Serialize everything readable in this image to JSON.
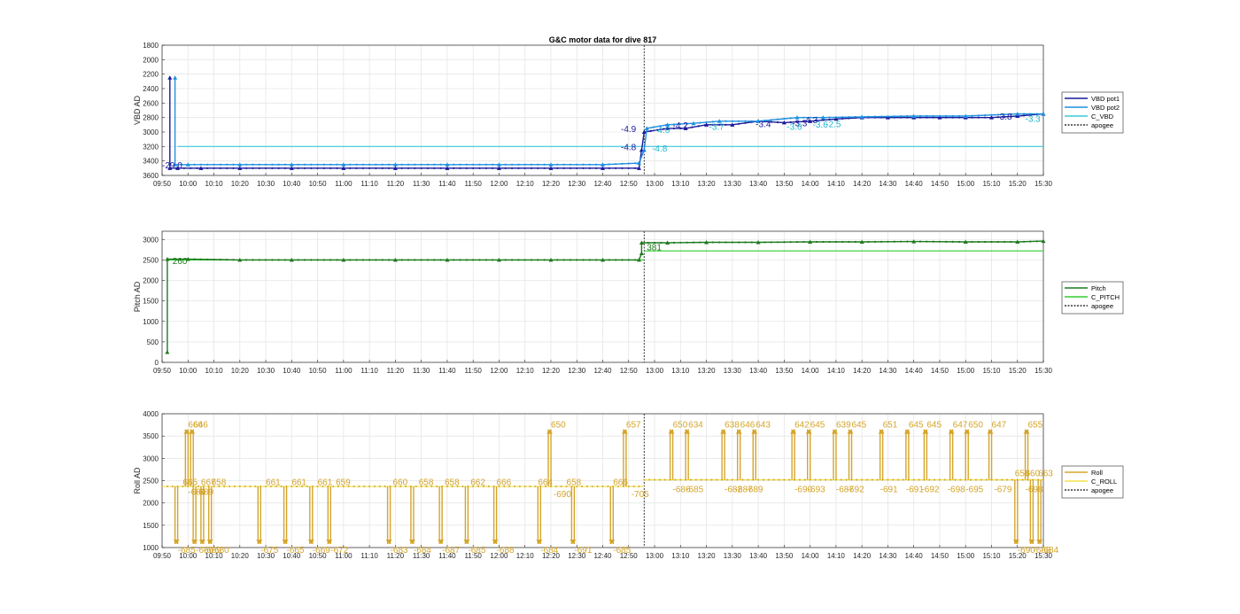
{
  "chart_data": [
    {
      "type": "line",
      "title": "G&C motor data for dive 817",
      "ylabel": "VBD AD",
      "ylim": [
        1800,
        3600
      ],
      "y_reversed": true,
      "yticks": [
        1800,
        2000,
        2200,
        2400,
        2600,
        2800,
        3000,
        3200,
        3400,
        3600
      ],
      "xlim": [
        "09:50",
        "15:30"
      ],
      "xticks": [
        "09:50",
        "10:00",
        "10:10",
        "10:20",
        "10:30",
        "10:40",
        "10:50",
        "11:00",
        "11:10",
        "11:20",
        "11:30",
        "11:40",
        "11:50",
        "12:00",
        "12:10",
        "12:20",
        "12:30",
        "12:40",
        "12:50",
        "13:00",
        "13:10",
        "13:20",
        "13:30",
        "13:40",
        "13:50",
        "14:00",
        "14:10",
        "14:20",
        "14:30",
        "14:40",
        "14:50",
        "15:00",
        "15:10",
        "15:20",
        "15:30"
      ],
      "grid": true,
      "legend_position": "right",
      "legend": [
        "VBD pot1",
        "VBD pot2",
        "C_VBD",
        "apogee"
      ],
      "colors": {
        "pot1": "#1a1a9a",
        "pot2": "#1e90e0",
        "c_vbd": "#3cc8dc",
        "apogee": "#333333"
      },
      "apogee_time": "12:56",
      "c_vbd_segments": [
        {
          "x0": "09:56",
          "x1": "12:56",
          "y": 3200
        },
        {
          "x0": "12:56",
          "x1": "15:30",
          "y": 3200
        }
      ],
      "series": [
        {
          "name": "VBD pot1",
          "points": [
            [
              "09:53",
              2250
            ],
            [
              "09:53",
              3500
            ],
            [
              "09:56",
              3500
            ],
            [
              "10:05",
              3500
            ],
            [
              "10:20",
              3500
            ],
            [
              "10:40",
              3500
            ],
            [
              "11:00",
              3500
            ],
            [
              "11:20",
              3500
            ],
            [
              "11:40",
              3500
            ],
            [
              "12:00",
              3500
            ],
            [
              "12:20",
              3500
            ],
            [
              "12:40",
              3500
            ],
            [
              "12:54",
              3500
            ],
            [
              "12:55",
              3250
            ],
            [
              "12:56",
              3000
            ],
            [
              "13:05",
              2950
            ],
            [
              "13:12",
              2950
            ],
            [
              "13:20",
              2900
            ],
            [
              "13:30",
              2900
            ],
            [
              "13:40",
              2850
            ],
            [
              "13:50",
              2870
            ],
            [
              "14:00",
              2850
            ],
            [
              "14:10",
              2820
            ],
            [
              "14:20",
              2800
            ],
            [
              "14:30",
              2800
            ],
            [
              "14:40",
              2800
            ],
            [
              "14:50",
              2800
            ],
            [
              "15:00",
              2800
            ],
            [
              "15:10",
              2800
            ],
            [
              "15:20",
              2780
            ],
            [
              "15:30",
              2750
            ]
          ]
        },
        {
          "name": "VBD pot2",
          "points": [
            [
              "09:55",
              2250
            ],
            [
              "09:55",
              3450
            ],
            [
              "10:00",
              3450
            ],
            [
              "10:20",
              3450
            ],
            [
              "10:40",
              3450
            ],
            [
              "11:00",
              3450
            ],
            [
              "11:20",
              3450
            ],
            [
              "11:40",
              3450
            ],
            [
              "12:00",
              3450
            ],
            [
              "12:20",
              3450
            ],
            [
              "12:40",
              3450
            ],
            [
              "12:54",
              3430
            ],
            [
              "12:56",
              3250
            ],
            [
              "12:57",
              2950
            ],
            [
              "13:05",
              2900
            ],
            [
              "13:15",
              2880
            ],
            [
              "13:25",
              2850
            ],
            [
              "13:40",
              2850
            ],
            [
              "13:55",
              2800
            ],
            [
              "14:05",
              2800
            ],
            [
              "14:20",
              2790
            ],
            [
              "14:40",
              2780
            ],
            [
              "15:00",
              2780
            ],
            [
              "15:20",
              2750
            ],
            [
              "15:30",
              2750
            ]
          ]
        }
      ],
      "annotations": [
        {
          "text": "-29.0",
          "x": "09:50",
          "y": 3500,
          "color": "#1a1a9a"
        },
        {
          "text": "-4.9",
          "x": "12:47",
          "y": 3000,
          "color": "#1a1a9a"
        },
        {
          "text": "-4.8",
          "x": "12:47",
          "y": 3250,
          "color": "#1a1a9a"
        },
        {
          "text": "-4.8",
          "x": "12:59",
          "y": 3270,
          "color": "#20b8d0"
        },
        {
          "text": "-4.6",
          "x": "13:00",
          "y": 3010,
          "color": "#20b8d0"
        },
        {
          "text": "-4.2",
          "x": "13:07",
          "y": 2950,
          "color": "#1a1a9a"
        },
        {
          "text": "-3.7",
          "x": "13:21",
          "y": 2970,
          "color": "#20b8d0"
        },
        {
          "text": "-3.4",
          "x": "13:39",
          "y": 2930,
          "color": "#1a1a9a"
        },
        {
          "text": "-3.3",
          "x": "13:53",
          "y": 2920,
          "color": "#1a1a9a"
        },
        {
          "text": "-3.6",
          "x": "13:51",
          "y": 2970,
          "color": "#20b8d0"
        },
        {
          "text": "-4.3",
          "x": "13:57",
          "y": 2880,
          "color": "#1a1a9a"
        },
        {
          "text": "-3.6",
          "x": "14:01",
          "y": 2940,
          "color": "#20b8d0"
        },
        {
          "text": "-2.5",
          "x": "14:06",
          "y": 2930,
          "color": "#20b8d0"
        },
        {
          "text": "-3.8",
          "x": "15:12",
          "y": 2830,
          "color": "#1a1a9a"
        },
        {
          "text": "-3.3",
          "x": "15:23",
          "y": 2860,
          "color": "#20b8d0"
        }
      ]
    },
    {
      "type": "line",
      "ylabel": "Pitch AD",
      "ylim": [
        0,
        3200
      ],
      "yticks": [
        0,
        500,
        1000,
        1500,
        2000,
        2500,
        3000
      ],
      "xlim": [
        "09:50",
        "15:30"
      ],
      "xticks": [
        "09:50",
        "10:00",
        "10:10",
        "10:20",
        "10:30",
        "10:40",
        "10:50",
        "11:00",
        "11:10",
        "11:20",
        "11:30",
        "11:40",
        "11:50",
        "12:00",
        "12:10",
        "12:20",
        "12:30",
        "12:40",
        "12:50",
        "13:00",
        "13:10",
        "13:20",
        "13:30",
        "13:40",
        "13:50",
        "14:00",
        "14:10",
        "14:20",
        "14:30",
        "14:40",
        "14:50",
        "15:00",
        "15:10",
        "15:20",
        "15:30"
      ],
      "grid": true,
      "legend_position": "right",
      "legend": [
        "Pitch",
        "C_PITCH",
        "apogee"
      ],
      "colors": {
        "pitch": "#1e7a1e",
        "c_pitch": "#33cc33",
        "apogee": "#333333"
      },
      "apogee_time": "12:56",
      "c_pitch_segments": [
        {
          "x0": "09:52",
          "x1": "12:56",
          "y": 2500
        },
        {
          "x0": "12:56",
          "x1": "15:30",
          "y": 2720
        }
      ],
      "series": [
        {
          "name": "Pitch",
          "points": [
            [
              "09:52",
              250
            ],
            [
              "09:52",
              2520
            ],
            [
              "10:00",
              2520
            ],
            [
              "10:20",
              2500
            ],
            [
              "10:40",
              2500
            ],
            [
              "11:00",
              2500
            ],
            [
              "11:20",
              2500
            ],
            [
              "11:40",
              2500
            ],
            [
              "12:00",
              2500
            ],
            [
              "12:20",
              2500
            ],
            [
              "12:40",
              2500
            ],
            [
              "12:54",
              2500
            ],
            [
              "12:55",
              2660
            ],
            [
              "12:55",
              2920
            ],
            [
              "13:05",
              2920
            ],
            [
              "13:20",
              2930
            ],
            [
              "13:40",
              2930
            ],
            [
              "14:00",
              2940
            ],
            [
              "14:20",
              2940
            ],
            [
              "14:40",
              2950
            ],
            [
              "15:00",
              2940
            ],
            [
              "15:20",
              2940
            ],
            [
              "15:30",
              2960
            ]
          ]
        }
      ],
      "annotations": [
        {
          "text": "260",
          "x": "09:54",
          "y": 2400,
          "color": "#1e7a1e"
        },
        {
          "text": "381",
          "x": "12:57",
          "y": 2730,
          "color": "#1e7a1e"
        }
      ]
    },
    {
      "type": "line",
      "ylabel": "Roll AD",
      "ylim": [
        1000,
        4000
      ],
      "yticks": [
        1000,
        1500,
        2000,
        2500,
        3000,
        3500,
        4000
      ],
      "xlim": [
        "09:50",
        "15:30"
      ],
      "xticks": [
        "09:50",
        "10:00",
        "10:10",
        "10:20",
        "10:30",
        "10:40",
        "10:50",
        "11:00",
        "11:10",
        "11:20",
        "11:30",
        "11:40",
        "11:50",
        "12:00",
        "12:10",
        "12:20",
        "12:30",
        "12:40",
        "12:50",
        "13:00",
        "13:10",
        "13:20",
        "13:30",
        "13:40",
        "13:50",
        "14:00",
        "14:10",
        "14:20",
        "14:30",
        "14:40",
        "14:50",
        "15:00",
        "15:10",
        "15:20",
        "15:30"
      ],
      "grid": true,
      "legend_position": "right",
      "legend": [
        "Roll",
        "C_ROLL",
        "apogee"
      ],
      "colors": {
        "roll": "#d4a52a",
        "c_roll": "#f2e24a",
        "apogee": "#333333"
      },
      "apogee_time": "12:56",
      "c_roll_segments": [
        {
          "x0": "09:50",
          "x1": "12:56",
          "y": 2370
        },
        {
          "x0": "12:56",
          "x1": "15:30",
          "y": 2520
        }
      ],
      "roll_excursions": [
        {
          "x": "09:55",
          "dir": "down",
          "label": "-685"
        },
        {
          "x": "09:59",
          "dir": "up",
          "label": "666"
        },
        {
          "x": "10:01",
          "dir": "up",
          "label": "646"
        },
        {
          "x": "10:02",
          "dir": "down",
          "label": "-686"
        },
        {
          "x": "10:05",
          "dir": "down",
          "label": "-689"
        },
        {
          "x": "10:08",
          "dir": "down",
          "label": "-680"
        },
        {
          "x": "10:27",
          "dir": "down",
          "label": "-675"
        },
        {
          "x": "10:37",
          "dir": "down",
          "label": "-665"
        },
        {
          "x": "10:47",
          "dir": "down",
          "label": "-669"
        },
        {
          "x": "10:54",
          "dir": "down",
          "label": "-672"
        },
        {
          "x": "11:17",
          "dir": "down",
          "label": "-683"
        },
        {
          "x": "11:26",
          "dir": "down",
          "label": "-684"
        },
        {
          "x": "11:37",
          "dir": "down",
          "label": "-687"
        },
        {
          "x": "11:47",
          "dir": "down",
          "label": "-685"
        },
        {
          "x": "11:58",
          "dir": "down",
          "label": "-688"
        },
        {
          "x": "12:15",
          "dir": "down",
          "label": "-684"
        },
        {
          "x": "12:19",
          "dir": "up",
          "label": "650"
        },
        {
          "x": "12:28",
          "dir": "down",
          "label": "-691"
        },
        {
          "x": "12:43",
          "dir": "down",
          "label": "-685"
        },
        {
          "x": "12:48",
          "dir": "up",
          "label": "657"
        },
        {
          "x": "13:06",
          "dir": "up",
          "label": "650"
        },
        {
          "x": "13:12",
          "dir": "up",
          "label": "634"
        },
        {
          "x": "13:26",
          "dir": "up",
          "label": "638"
        },
        {
          "x": "13:32",
          "dir": "up",
          "label": "646"
        },
        {
          "x": "13:38",
          "dir": "up",
          "label": "643"
        },
        {
          "x": "13:53",
          "dir": "up",
          "label": "642"
        },
        {
          "x": "13:59",
          "dir": "up",
          "label": "645"
        },
        {
          "x": "14:09",
          "dir": "up",
          "label": "639"
        },
        {
          "x": "14:15",
          "dir": "up",
          "label": "645"
        },
        {
          "x": "14:27",
          "dir": "up",
          "label": "651"
        },
        {
          "x": "14:37",
          "dir": "up",
          "label": "645"
        },
        {
          "x": "14:44",
          "dir": "up",
          "label": "645"
        },
        {
          "x": "14:54",
          "dir": "up",
          "label": "647"
        },
        {
          "x": "15:00",
          "dir": "up",
          "label": "650"
        },
        {
          "x": "15:09",
          "dir": "up",
          "label": "647"
        },
        {
          "x": "15:19",
          "dir": "down",
          "label": "-690"
        },
        {
          "x": "15:23",
          "dir": "up",
          "label": "655"
        },
        {
          "x": "15:25",
          "dir": "down",
          "label": "-688"
        },
        {
          "x": "15:28",
          "dir": "down",
          "label": "-684"
        }
      ],
      "extra_labels": [
        {
          "text": "665",
          "x": "09:58",
          "y": 2400
        },
        {
          "text": "-686",
          "x": "10:00",
          "y": 2180
        },
        {
          "text": "-689",
          "x": "10:03",
          "y": 2180
        },
        {
          "text": "667",
          "x": "10:05",
          "y": 2400
        },
        {
          "text": "658",
          "x": "10:09",
          "y": 2400
        },
        {
          "text": "661",
          "x": "10:30",
          "y": 2400
        },
        {
          "text": "661",
          "x": "10:40",
          "y": 2400
        },
        {
          "text": "661",
          "x": "10:50",
          "y": 2400
        },
        {
          "text": "659",
          "x": "10:57",
          "y": 2400
        },
        {
          "text": "660",
          "x": "11:19",
          "y": 2400
        },
        {
          "text": "658",
          "x": "11:29",
          "y": 2400
        },
        {
          "text": "658",
          "x": "11:39",
          "y": 2400
        },
        {
          "text": "662",
          "x": "11:49",
          "y": 2400
        },
        {
          "text": "666",
          "x": "11:59",
          "y": 2400
        },
        {
          "text": "664",
          "x": "12:15",
          "y": 2400
        },
        {
          "text": "-690",
          "x": "12:21",
          "y": 2130
        },
        {
          "text": "658",
          "x": "12:26",
          "y": 2400
        },
        {
          "text": "666",
          "x": "12:44",
          "y": 2400
        },
        {
          "text": "-705",
          "x": "12:51",
          "y": 2130
        },
        {
          "text": "-686",
          "x": "13:07",
          "y": 2240
        },
        {
          "text": "-685",
          "x": "13:12",
          "y": 2240
        },
        {
          "text": "-682",
          "x": "13:27",
          "y": 2240
        },
        {
          "text": "-687",
          "x": "13:31",
          "y": 2240
        },
        {
          "text": "-689",
          "x": "13:35",
          "y": 2240
        },
        {
          "text": "-690",
          "x": "13:54",
          "y": 2240
        },
        {
          "text": "-693",
          "x": "13:59",
          "y": 2240
        },
        {
          "text": "-687",
          "x": "14:10",
          "y": 2240
        },
        {
          "text": "-692",
          "x": "14:14",
          "y": 2240
        },
        {
          "text": "-691",
          "x": "14:27",
          "y": 2240
        },
        {
          "text": "-691",
          "x": "14:37",
          "y": 2240
        },
        {
          "text": "-692",
          "x": "14:43",
          "y": 2240
        },
        {
          "text": "-698",
          "x": "14:53",
          "y": 2240
        },
        {
          "text": "-695",
          "x": "15:00",
          "y": 2240
        },
        {
          "text": "-679",
          "x": "15:11",
          "y": 2240
        },
        {
          "text": "658",
          "x": "15:19",
          "y": 2600
        },
        {
          "text": "660",
          "x": "15:23",
          "y": 2600
        },
        {
          "text": "663",
          "x": "15:28",
          "y": 2600
        },
        {
          "text": "-698",
          "x": "15:23",
          "y": 2240
        }
      ]
    }
  ]
}
